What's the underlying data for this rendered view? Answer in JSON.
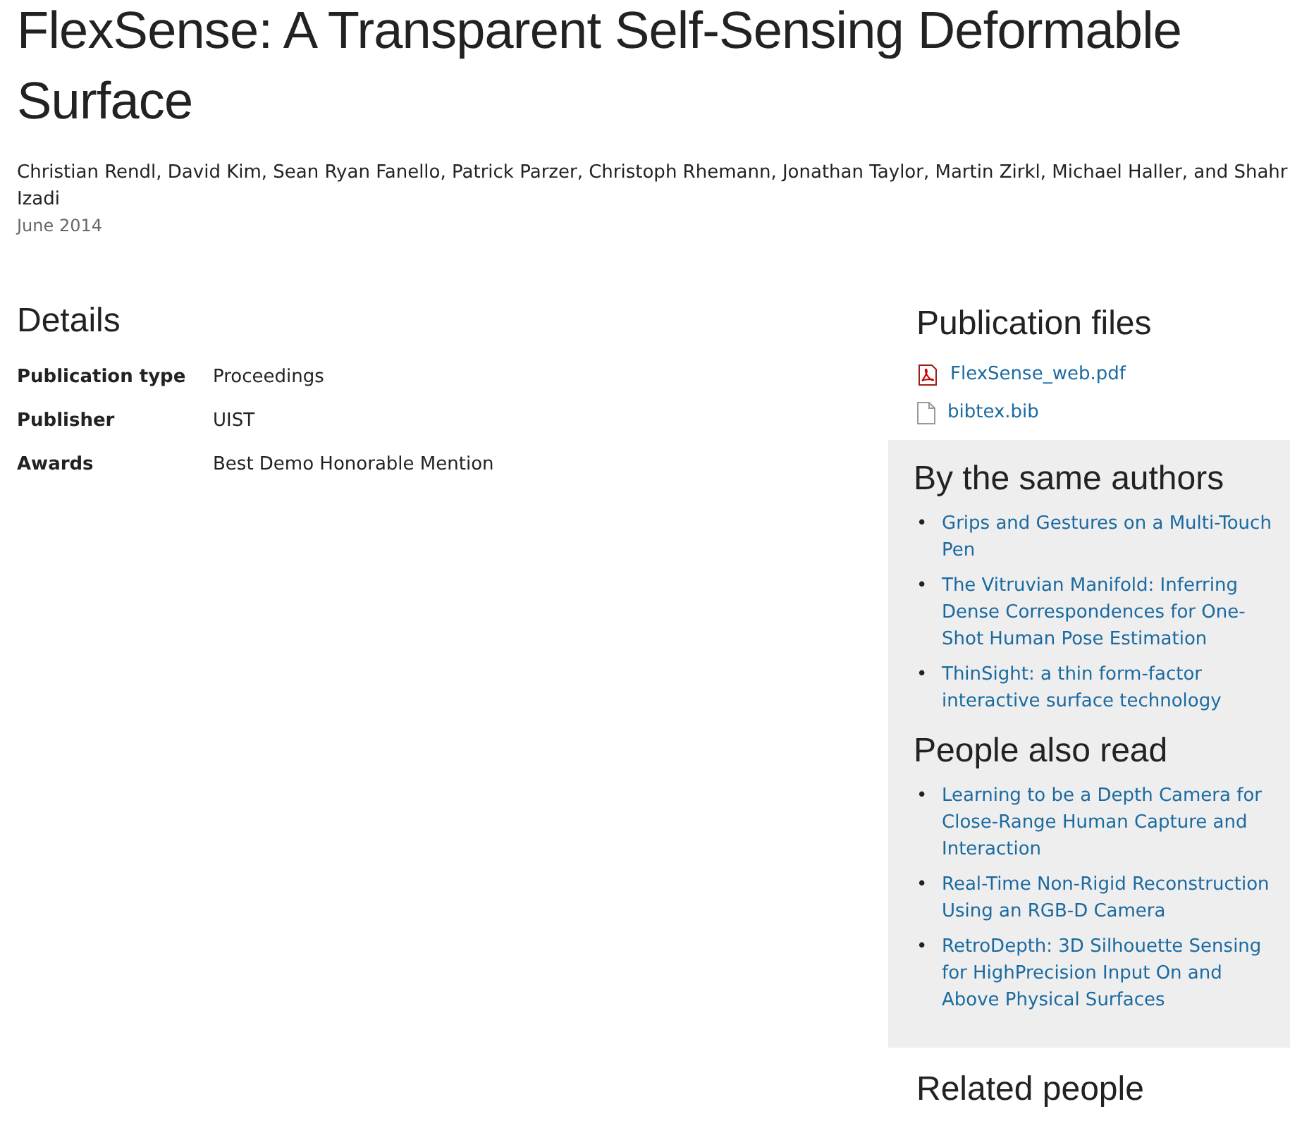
{
  "title": "FlexSense: A Transparent Self-Sensing Deformable Surface",
  "author_lines": [
    "Christian Rendl, David Kim, Sean Ryan Fanello, Patrick Parzer, Christoph Rhemann, Jonathan Taylor, Martin Zirkl, Michael Haller, and Shahr",
    "Izadi"
  ],
  "date": "June 2014",
  "details": {
    "heading": "Details",
    "rows": [
      {
        "label": "Publication type",
        "value": "Proceedings"
      },
      {
        "label": "Publisher",
        "value": "UIST"
      },
      {
        "label": "Awards",
        "value": "Best Demo Honorable Mention"
      }
    ]
  },
  "files": {
    "heading": "Publication files",
    "items": [
      {
        "kind": "pdf",
        "name": "FlexSense_web.pdf"
      },
      {
        "kind": "file",
        "name": "bibtex.bib"
      }
    ]
  },
  "related": [
    {
      "heading": "By the same authors",
      "links": [
        {
          "marker": "•",
          "text": "Grips and Gestures on a Multi-Touch Pen"
        },
        {
          "marker": "•",
          "text": "The Vitruvian Manifold: Inferring Dense Correspondences for One-Shot Human Pose Estimation"
        },
        {
          "marker": "•",
          "text": "ThinSight: a thin form-factor interactive surface technology"
        }
      ]
    },
    {
      "heading": "People also read",
      "links": [
        {
          "marker": "•",
          "text": "Learning to be a Depth Camera for Close-Range Human Capture and Interaction"
        },
        {
          "marker": "•",
          "text": "Real-Time Non-Rigid Reconstruction Using an RGB-D Camera"
        },
        {
          "marker": "•",
          "text": "RetroDepth: 3D Silhouette Sensing for HighPrecision Input On and Above Physical Surfaces"
        }
      ]
    }
  ],
  "related_people": {
    "heading": "Related people"
  }
}
